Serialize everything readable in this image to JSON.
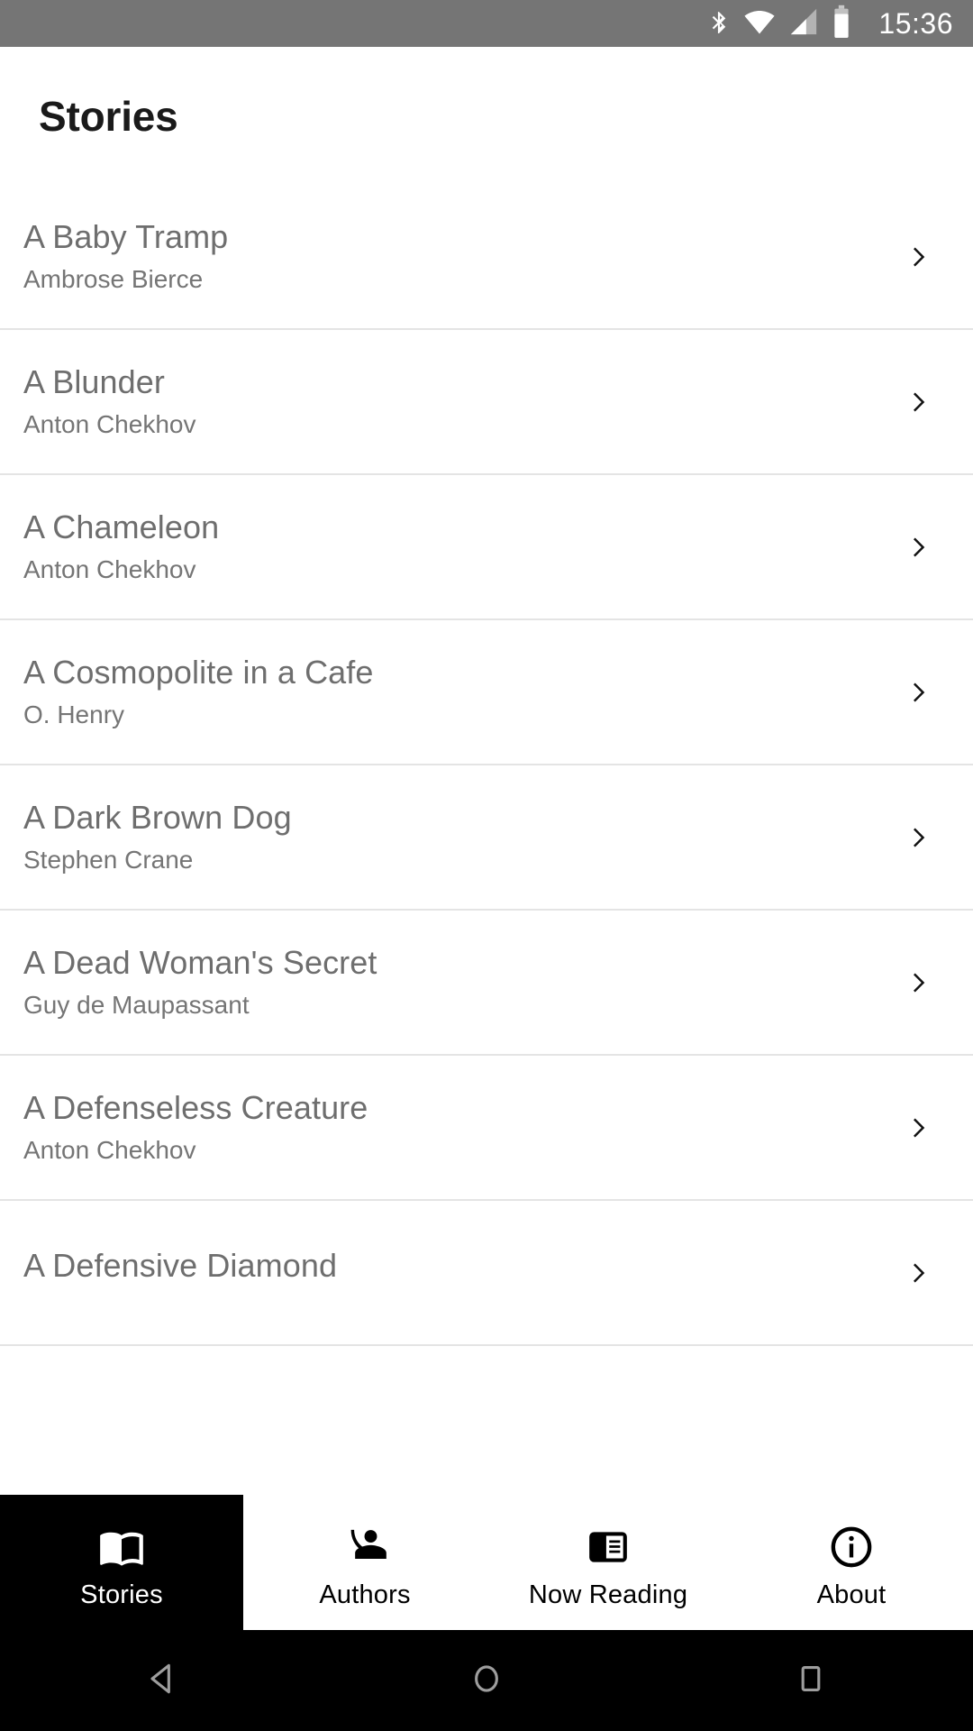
{
  "status_bar": {
    "time": "15:36",
    "icons": [
      "bluetooth-icon",
      "wifi-icon",
      "cellular-signal-icon",
      "battery-icon"
    ],
    "background_color": "#757575",
    "foreground_color": "#ffffff"
  },
  "app_bar": {
    "title": "Stories"
  },
  "stories": [
    {
      "title": "A Baby Tramp",
      "author": "Ambrose Bierce"
    },
    {
      "title": "A Blunder",
      "author": "Anton Chekhov"
    },
    {
      "title": "A Chameleon",
      "author": "Anton Chekhov"
    },
    {
      "title": "A Cosmopolite in a Cafe",
      "author": "O. Henry"
    },
    {
      "title": "A Dark Brown Dog",
      "author": "Stephen Crane"
    },
    {
      "title": "A Dead Woman's Secret",
      "author": "Guy de Maupassant"
    },
    {
      "title": "A Defenseless Creature",
      "author": "Anton Chekhov"
    },
    {
      "title": "A Defensive Diamond",
      "author": ""
    }
  ],
  "list_chevron_icon": "chevron-right-icon",
  "bottom_nav": {
    "active_index": 0,
    "active_background": "#000000",
    "active_foreground": "#ffffff",
    "tabs": [
      {
        "label": "Stories",
        "icon": "open-book-icon"
      },
      {
        "label": "Authors",
        "icon": "record-voice-over-icon"
      },
      {
        "label": "Now Reading",
        "icon": "reader-mode-icon"
      },
      {
        "label": "About",
        "icon": "info-circle-icon"
      }
    ]
  },
  "system_nav": {
    "buttons": [
      {
        "name": "back-button",
        "icon": "back-triangle-icon"
      },
      {
        "name": "home-button",
        "icon": "home-circle-icon"
      },
      {
        "name": "recents-button",
        "icon": "recents-square-icon"
      }
    ],
    "background_color": "#000000",
    "icon_color": "#9e9e9e"
  }
}
